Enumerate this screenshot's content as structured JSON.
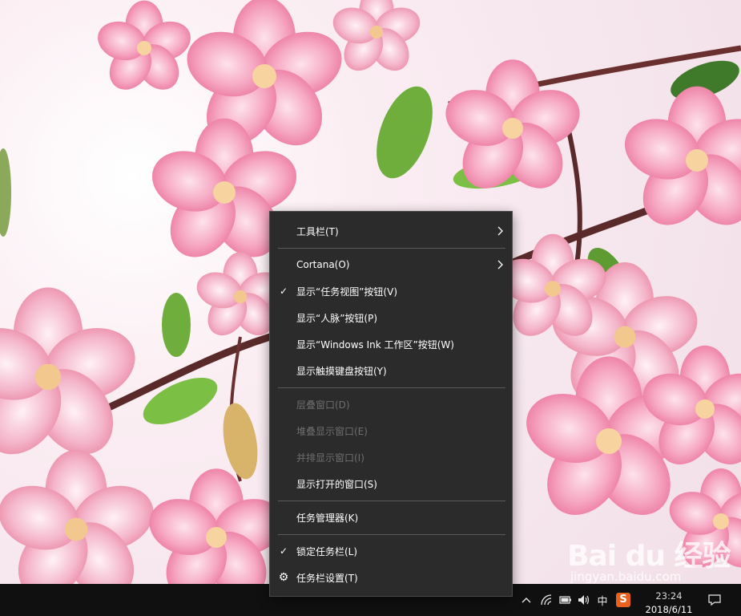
{
  "context_menu": {
    "items": [
      {
        "label": "工具栏(T)",
        "checked": false,
        "submenu": true,
        "disabled": false,
        "icon": ""
      },
      {
        "label": "Cortana(O)",
        "checked": false,
        "submenu": true,
        "disabled": false,
        "icon": ""
      },
      {
        "label": "显示“任务视图”按钮(V)",
        "checked": true,
        "submenu": false,
        "disabled": false,
        "icon": "checkmark-icon"
      },
      {
        "label": "显示“人脉”按钮(P)",
        "checked": false,
        "submenu": false,
        "disabled": false,
        "icon": ""
      },
      {
        "label": "显示“Windows Ink 工作区”按钮(W)",
        "checked": false,
        "submenu": false,
        "disabled": false,
        "icon": ""
      },
      {
        "label": "显示触摸键盘按钮(Y)",
        "checked": false,
        "submenu": false,
        "disabled": false,
        "icon": ""
      },
      {
        "label": "层叠窗口(D)",
        "checked": false,
        "submenu": false,
        "disabled": true,
        "icon": ""
      },
      {
        "label": "堆叠显示窗口(E)",
        "checked": false,
        "submenu": false,
        "disabled": true,
        "icon": ""
      },
      {
        "label": "并排显示窗口(I)",
        "checked": false,
        "submenu": false,
        "disabled": true,
        "icon": ""
      },
      {
        "label": "显示打开的窗口(S)",
        "checked": false,
        "submenu": false,
        "disabled": false,
        "icon": ""
      },
      {
        "label": "任务管理器(K)",
        "checked": false,
        "submenu": false,
        "disabled": false,
        "icon": ""
      },
      {
        "label": "锁定任务栏(L)",
        "checked": true,
        "submenu": false,
        "disabled": false,
        "icon": "checkmark-icon"
      },
      {
        "label": "任务栏设置(T)",
        "checked": false,
        "submenu": false,
        "disabled": false,
        "icon": "gear-icon"
      }
    ],
    "check_glyph": "✓",
    "gear_glyph": "⚙"
  },
  "taskbar": {
    "tray_icons": [
      "chevron-up-icon",
      "network-icon",
      "battery-icon",
      "volume-icon",
      "ime-icon",
      "sogou-icon",
      "notification-icon"
    ],
    "ime_label": "中",
    "sogou_label": "S",
    "chevron_glyph": "^",
    "clock": {
      "time": "23:24",
      "date": "2018/6/11"
    }
  },
  "watermark": {
    "logo": "Bai du 经验",
    "sub": "jingyan.baidu.com"
  },
  "colors": {
    "menu_bg": "#2b2b2b",
    "menu_text": "#ffffff",
    "disabled_text": "#6e6e6e",
    "taskbar_bg": "#101010",
    "blossom": "#f29bb8"
  }
}
